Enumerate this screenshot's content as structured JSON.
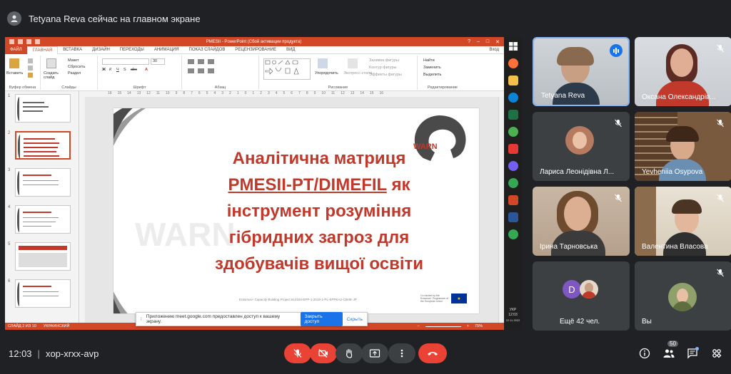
{
  "meet": {
    "presenter_banner": "Tetyana Reva сейчас на главном экране",
    "time": "12:03",
    "meeting_code": "xop-xrxx-avp",
    "people_count": "50"
  },
  "powerpoint": {
    "window_title": "PMESII - PowerPoint (Сбой активации продукта)",
    "account_label": "Вход",
    "tabs": [
      "ФАЙЛ",
      "ГЛАВНАЯ",
      "ВСТАВКА",
      "ДИЗАЙН",
      "ПЕРЕХОДЫ",
      "АНИМАЦИЯ",
      "ПОКАЗ СЛАЙДОВ",
      "РЕЦЕНЗИРОВАНИЕ",
      "ВИД"
    ],
    "ribbon": {
      "paste": "Вставить",
      "layout": "Макет",
      "reset": "Сбросить",
      "section": "Раздел",
      "new_slide": "Создать слайд",
      "clipboard_group": "Буфер обмена",
      "slides_group": "Слайды",
      "font_group": "Шрифт",
      "paragraph_group": "Абзац",
      "font_size": "30",
      "arrange": "Упорядочить",
      "quick_styles": "Экспресс-стили",
      "shape_fill": "Заливка фигуры",
      "shape_outline": "Контур фигуры",
      "shape_effects": "Эффекты фигуры",
      "drawing_group": "Рисование",
      "find": "Найти",
      "replace": "Заменить",
      "select": "Выделить",
      "editing_group": "Редактирование"
    },
    "ruler_ticks": [
      "16",
      "15",
      "14",
      "13",
      "12",
      "11",
      "10",
      "9",
      "8",
      "7",
      "6",
      "5",
      "4",
      "3",
      "2",
      "1",
      "0",
      "1",
      "2",
      "3",
      "4",
      "5",
      "6",
      "7",
      "8",
      "9",
      "10",
      "11",
      "12",
      "13",
      "14",
      "15",
      "16"
    ],
    "thumb_numbers": [
      "1",
      "2",
      "3",
      "4",
      "5",
      "6"
    ],
    "slide": {
      "title_lines": [
        "Аналітична матриця",
        "PMESII-PT/DIMEFIL",
        "як",
        "інструмент розуміння",
        "гібридних загроз для",
        "здобувачів вищої освіти"
      ],
      "logo_text": "WARN",
      "watermark": "WARN",
      "footer": "Erasmus+ Capacity Building Project 610153-EPP-1-2019-1-PL-EPPKA2-CBHE-JP",
      "eu_text": "Co-funded by the Erasmus+ Programme of the European Union"
    },
    "status": {
      "slide_info": "СЛАЙД 2 ИЗ 10",
      "language": "УКРАИНСКИЙ",
      "zoom": "75%"
    }
  },
  "taskbar": {
    "lang": "УКР",
    "time": "12:03",
    "date": "22.11.2022"
  },
  "share_notice": {
    "text": "Приложению meet.google.com предоставлен доступ к вашему экрану.",
    "stop": "Закрыть доступ",
    "hide": "Скрыть"
  },
  "participants": [
    {
      "name": "Tetyana Reva"
    },
    {
      "name": "Оксана Олександрів..."
    },
    {
      "name": "Лариса Леонідівна Л..."
    },
    {
      "name": "Yevheniia Osypova"
    },
    {
      "name": "Ірина Тарновська"
    },
    {
      "name": "Валентина Власова"
    },
    {
      "name": "Ещё 42 чел.",
      "avatar_letter": "D"
    },
    {
      "name": "Вы"
    }
  ],
  "colors": {
    "meet_bg": "#202124",
    "tile_bg": "#3c4043",
    "hangup_red": "#ea4335",
    "pp_orange": "#d24726",
    "slide_red": "#c0392b",
    "speaking_blue": "#8ab4f8"
  }
}
